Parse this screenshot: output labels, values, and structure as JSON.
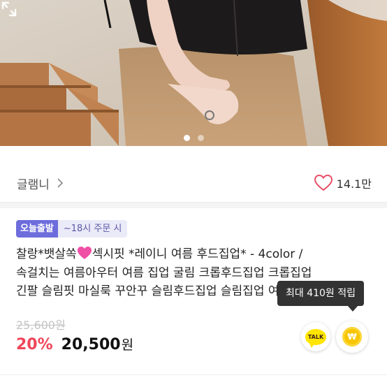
{
  "hero": {
    "image_alt": "",
    "slide_count": 2,
    "active_slide": 1,
    "expand_icon": "expand-arrows-icon"
  },
  "brand": {
    "name": "글램니",
    "chevron_icon": "chevron-right-icon"
  },
  "likes": {
    "count": "14.1만",
    "icon": "heart-outline-icon",
    "color": "#e94f66"
  },
  "badges": {
    "today": "오늘출발",
    "time": "~18시 주문 시"
  },
  "product": {
    "title_line1_a": "찰랑*뱃살쏙",
    "title_line1_b": "섹시핏 *레이니 여름 후드집업* - 4color /",
    "title_line2": "속걸치는 여름아우터 여름 집업 굴림 크롭후드집업 크롭집업",
    "title_line3": "긴팔 슬림핏 마실룩 꾸안꾸 슬림후드집업 슬림집업 여성",
    "original_price": "25,600원",
    "discount": "20%",
    "price": "20,500",
    "price_unit": "원"
  },
  "tooltip": {
    "text": "최대 410원 적립"
  },
  "actions": {
    "talk_label": "TALK",
    "won_label": "₩"
  },
  "colors": {
    "badge_primary": "#6d6ddc",
    "discount": "#f0455a",
    "kakao": "#ffe500",
    "coin": "#f7c600"
  }
}
